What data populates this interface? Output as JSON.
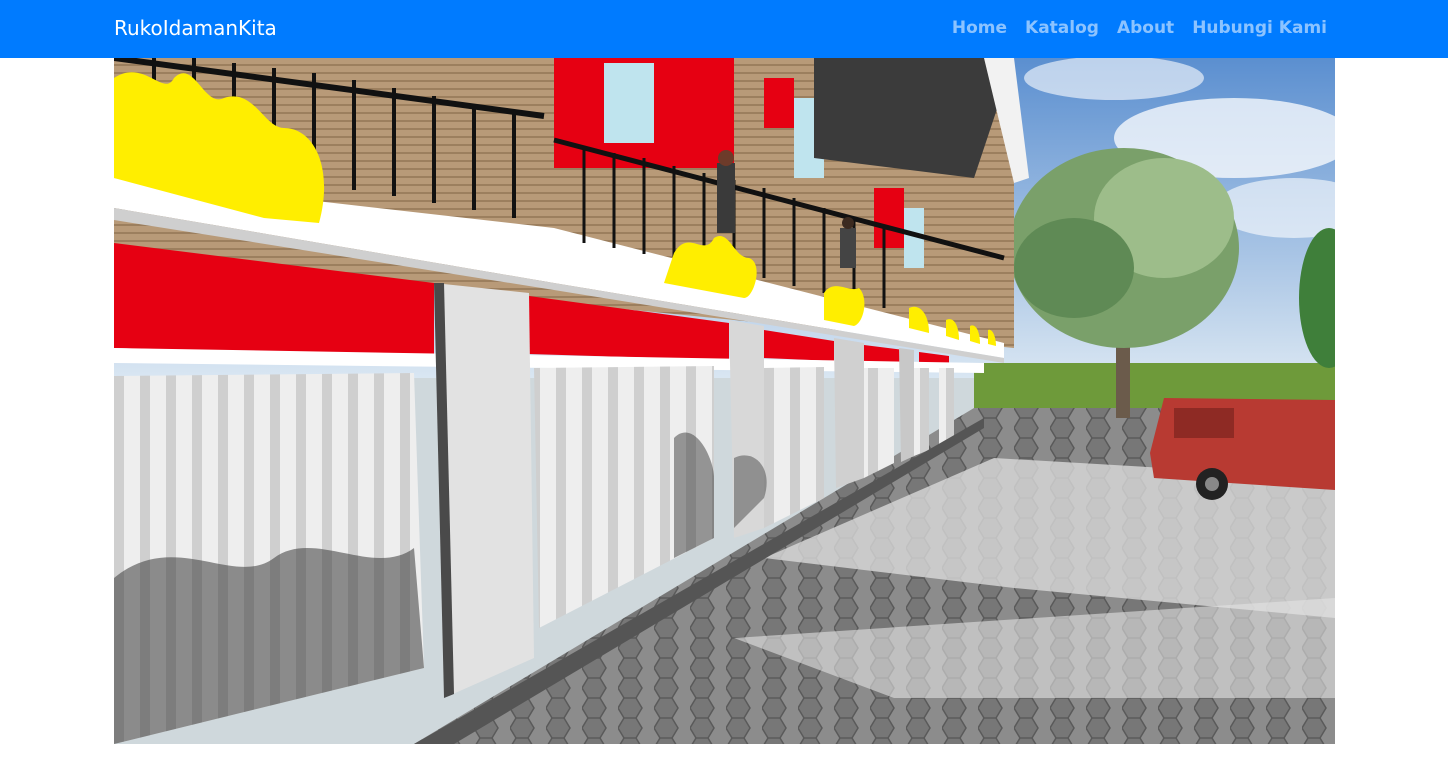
{
  "navbar": {
    "brand": "RukoIdamanKita",
    "links": [
      {
        "label": "Home"
      },
      {
        "label": "Katalog"
      },
      {
        "label": "About"
      },
      {
        "label": "Hubungi Kami"
      }
    ],
    "background_color": "#007bff"
  },
  "hero": {
    "image_description_icon": "shophouse-render-image",
    "colors": {
      "sky": "#6fa3d6",
      "facade_red": "#e60012",
      "ornament_yellow": "#ffee00",
      "shutter": "#e6e6e6",
      "pavement": "#8a8a8a",
      "grass": "#6e9a3a",
      "van": "#b83a32"
    }
  }
}
